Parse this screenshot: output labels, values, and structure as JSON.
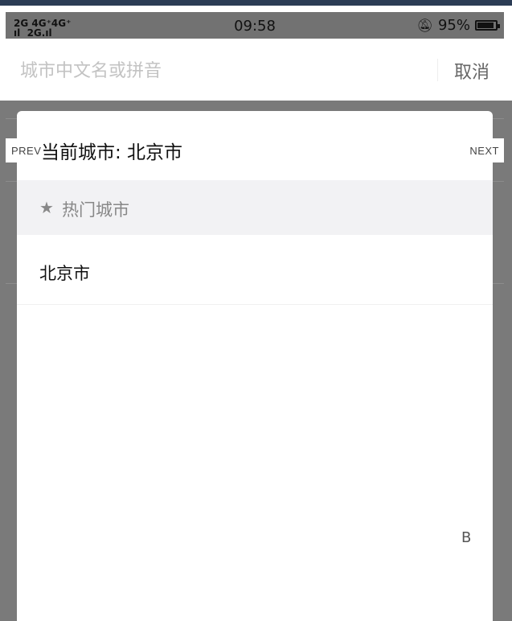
{
  "status_bar": {
    "signal_text": "2G 4G⁺4G⁺\nıl  2G.ıl",
    "time": "09:58",
    "battery_percent": "95%",
    "battery_level": 0.95,
    "icons": [
      "signal-icon",
      "bell-muted-icon",
      "battery-icon"
    ]
  },
  "search": {
    "placeholder": "城市中文名或拼音",
    "value": "",
    "cancel_label": "取消"
  },
  "picker": {
    "current_city_label": "当前城市: 北京市",
    "hot_section": {
      "star": "★",
      "title": "热门城市"
    },
    "cities": [
      "北京市"
    ],
    "index_letters": [
      "B"
    ]
  },
  "nav": {
    "prev_label": "PREV",
    "next_label": "NEXT"
  },
  "colors": {
    "overlay": "#7a7a7a",
    "section_bg": "#f2f2f4",
    "placeholder": "#c3c3c3",
    "top_strip": "#2b3c55"
  }
}
